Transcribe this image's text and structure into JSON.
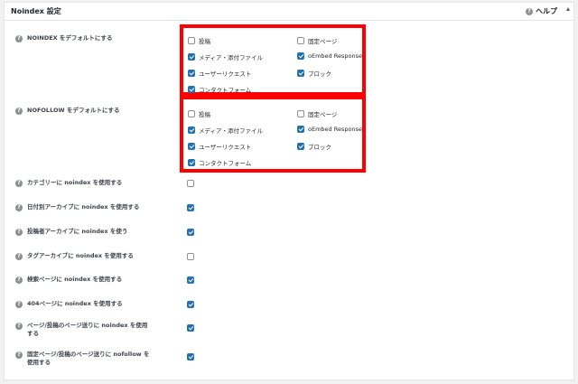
{
  "panel": {
    "title": "Noindex 設定",
    "help_label": "ヘルプ",
    "icons": {
      "help": "question-circle-icon",
      "collapse": "triangle-up-icon"
    }
  },
  "options_labels": {
    "post": "投稿",
    "page": "固定ページ",
    "media": "メディア・添付ファイル",
    "oembed": "oEmbed Response",
    "user_request": "ユーザーリクエスト",
    "block": "ブロック",
    "contact_form": "コンタクトフォーム"
  },
  "noindex_default": {
    "label": "NOINDEX をデフォルトにする",
    "values": {
      "post": false,
      "page": false,
      "media": true,
      "oembed": true,
      "user_request": true,
      "block": true,
      "contact_form": true
    }
  },
  "nofollow_default": {
    "label": "NOFOLLOW をデフォルトにする",
    "values": {
      "post": false,
      "page": false,
      "media": true,
      "oembed": true,
      "user_request": true,
      "block": true,
      "contact_form": true
    }
  },
  "settings": [
    {
      "key": "category",
      "label": "カテゴリーに noindex を使用する",
      "checked": false
    },
    {
      "key": "date_archive",
      "label": "日付別アーカイブに noindex を使用する",
      "checked": true
    },
    {
      "key": "author_archive",
      "label": "投稿者アーカイブに noindex を使う",
      "checked": true
    },
    {
      "key": "tag_archive",
      "label": "タグアーカイブに noindex を使用する",
      "checked": false
    },
    {
      "key": "search",
      "label": "検索ページに noindex を使用する",
      "checked": true
    },
    {
      "key": "404",
      "label": "404ページに noindex を使用する",
      "checked": true
    },
    {
      "key": "paginated",
      "label": "ページ/投稿のページ送りに noindex を使用する",
      "checked": true
    },
    {
      "key": "page_paginated_nofollow",
      "label": "固定ページ/投稿のページ送りに nofollow を使用する",
      "checked": true
    }
  ],
  "colors": {
    "highlight": "#ff0000",
    "checkbox_checked": "#2271b1"
  }
}
